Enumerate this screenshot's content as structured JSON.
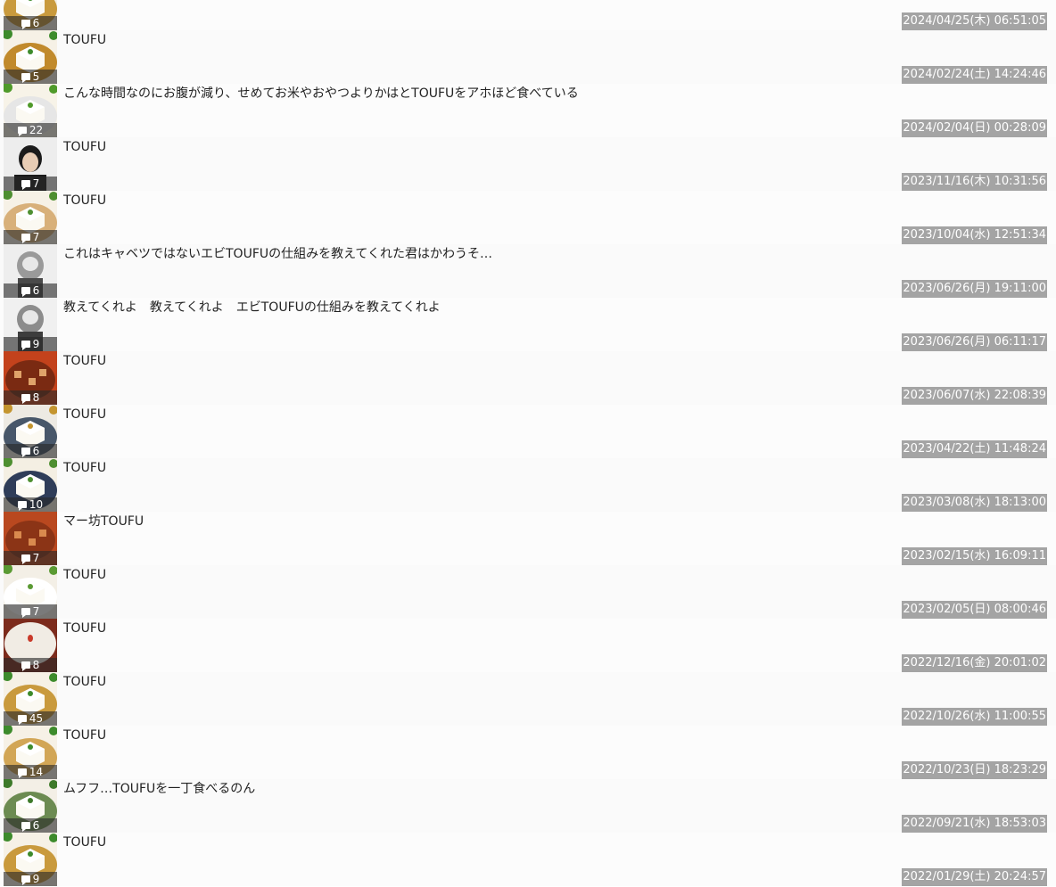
{
  "posts": [
    {
      "title": "",
      "comments": "6",
      "date": "2024/04/25(木) 06:51:05",
      "thumb": "tofu-plate-icon",
      "colors": [
        "#f3efe5",
        "#c99a3d",
        "#3d8b2c"
      ]
    },
    {
      "title": "TOUFU",
      "comments": "5",
      "date": "2024/02/24(土) 14:24:46",
      "thumb": "tofu-plate-icon",
      "colors": [
        "#f6f1e6",
        "#c18a2c",
        "#3d8b2c"
      ]
    },
    {
      "title": "こんな時間なのにお腹が減り、せめてお米やおやつよりかはとTOUFUをアホほど食べている",
      "comments": "22",
      "date": "2024/02/04(日) 00:28:09",
      "thumb": "tofu-plate-icon",
      "colors": [
        "#f7f3e8",
        "#e6e6e6",
        "#4f9a2a"
      ]
    },
    {
      "title": "TOUFU",
      "comments": "7",
      "date": "2023/11/16(木) 10:31:56",
      "thumb": "person-avatar-icon",
      "colors": [
        "#ededed",
        "#1b1b1b",
        "#e8cdb5"
      ]
    },
    {
      "title": "TOUFU",
      "comments": "7",
      "date": "2023/10/04(水) 12:51:34",
      "thumb": "tofu-plate-icon",
      "colors": [
        "#f6f1e6",
        "#d8b07a",
        "#4e8f31"
      ]
    },
    {
      "title": "これはキャベツではないエビTOUFUの仕組みを教えてくれた君はかわうそ…",
      "comments": "6",
      "date": "2023/06/26(月) 19:11:00",
      "thumb": "character-avatar-icon",
      "colors": [
        "#eeeeee",
        "#4a4a4a",
        "#9a9a9a"
      ]
    },
    {
      "title": "教えてくれよ　教えてくれよ　エビTOUFUの仕組みを教えてくれよ",
      "comments": "9",
      "date": "2023/06/26(月) 06:11:17",
      "thumb": "character-avatar-icon",
      "colors": [
        "#f0f0f0",
        "#3d3d3d",
        "#8c8c8c"
      ]
    },
    {
      "title": "TOUFU",
      "comments": "8",
      "date": "2023/06/07(水) 22:08:39",
      "thumb": "mapo-tofu-icon",
      "colors": [
        "#7a2a12",
        "#c3421c",
        "#e0a36a"
      ]
    },
    {
      "title": "TOUFU",
      "comments": "6",
      "date": "2023/04/22(土) 11:48:24",
      "thumb": "tofu-plate-icon",
      "colors": [
        "#edeae3",
        "#48576a",
        "#c4952f"
      ]
    },
    {
      "title": "TOUFU",
      "comments": "10",
      "date": "2023/03/08(水) 18:13:00",
      "thumb": "tofu-plate-icon",
      "colors": [
        "#f4efe3",
        "#2f3d59",
        "#4e8f31"
      ]
    },
    {
      "title": "マー坊TOUFU",
      "comments": "7",
      "date": "2023/02/15(水) 16:09:11",
      "thumb": "mapo-tofu-icon",
      "colors": [
        "#8b3416",
        "#b9481f",
        "#d98a4e"
      ]
    },
    {
      "title": "TOUFU",
      "comments": "7",
      "date": "2023/02/05(日) 08:00:46",
      "thumb": "tofu-plate-icon",
      "colors": [
        "#f3efe6",
        "#ffffff",
        "#5a9a33"
      ]
    },
    {
      "title": "TOUFU",
      "comments": "8",
      "date": "2022/12/16(金) 20:01:02",
      "thumb": "tofu-bowl-icon",
      "colors": [
        "#f1ece4",
        "#7c2b1c",
        "#c93a2a"
      ]
    },
    {
      "title": "TOUFU",
      "comments": "45",
      "date": "2022/10/26(水) 11:00:55",
      "thumb": "tofu-plate-icon",
      "colors": [
        "#f6f1e6",
        "#c99a3d",
        "#3d8b2c"
      ]
    },
    {
      "title": "TOUFU",
      "comments": "14",
      "date": "2022/10/23(日) 18:23:29",
      "thumb": "tofu-plate-icon",
      "colors": [
        "#f6f1e6",
        "#d2a656",
        "#3d8b2c"
      ]
    },
    {
      "title": "ムフフ…TOUFUを一丁食べるのん",
      "comments": "6",
      "date": "2022/09/21(水) 18:53:03",
      "thumb": "tofu-plate-icon",
      "colors": [
        "#f3efe6",
        "#6c8b52",
        "#3d7a2a"
      ]
    },
    {
      "title": "TOUFU",
      "comments": "9",
      "date": "2022/01/29(土) 20:24:57",
      "thumb": "tofu-plate-icon",
      "colors": [
        "#f6f1e6",
        "#c99a3d",
        "#3d8b2c"
      ]
    }
  ]
}
